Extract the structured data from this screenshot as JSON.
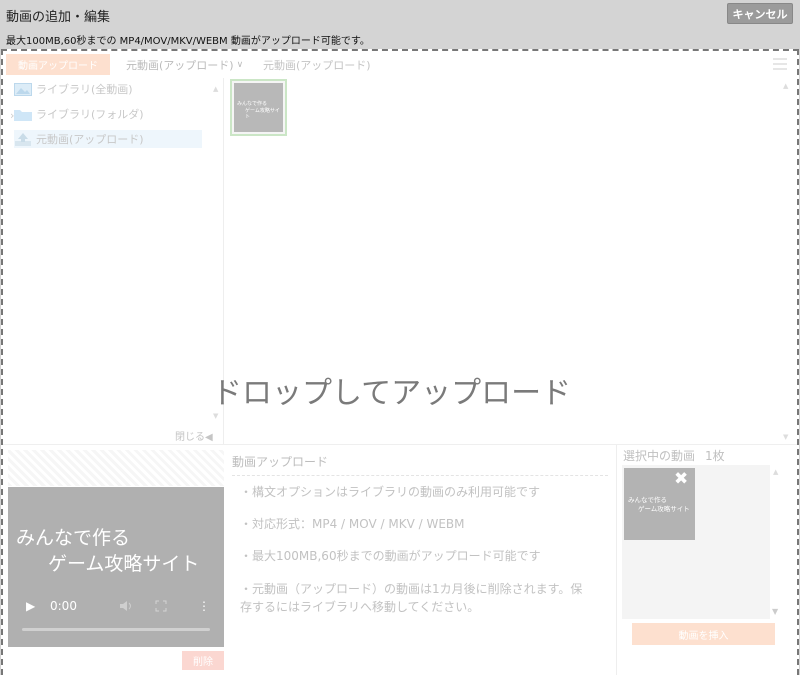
{
  "header": {
    "title": "動画の追加・編集",
    "cancel_label": "キャンセル",
    "note": "最大100MB,60秒までの MP4/MOV/MKV/WEBM 動画がアップロード可能です。"
  },
  "toolbar": {
    "upload_tab": "動画アップロード",
    "source_select": "元動画(アップロード)",
    "breadcrumb": "元動画(アップロード)"
  },
  "sidebar": {
    "items": [
      {
        "label": "ライブラリ(全動画)",
        "icon": "image-icon"
      },
      {
        "label": "ライブラリ(フォルダ)",
        "icon": "folder-icon"
      },
      {
        "label": "元動画(アップロード)",
        "icon": "upload-icon"
      }
    ],
    "close_label": "閉じる◀"
  },
  "grid": {
    "thumb_line1": "みんなで作る",
    "thumb_line2": "ゲーム攻略サイト"
  },
  "drop_text": "ドロップしてアップロード",
  "preview": {
    "line1": "みんなで作る",
    "line2": "ゲーム攻略サイト",
    "time": "0:00",
    "delete_label": "削除"
  },
  "info": {
    "title": "動画アップロード",
    "lines": [
      "・構文オプションはライブラリの動画のみ利用可能です",
      "・対応形式：MP4 / MOV / MKV / WEBM",
      "・最大100MB,60秒までの動画がアップロード可能です",
      "・元動画（アップロード）の動画は1カ月後に削除されます。保",
      "存するにはライブラリへ移動してください。"
    ]
  },
  "selected": {
    "title": "選択中の動画",
    "count": "1枚",
    "thumb_line1": "みんなで作る",
    "thumb_line2": "ゲーム攻略サイト",
    "insert_label": "動画を挿入"
  },
  "colors": {
    "accent": "#f5a57a",
    "delete": "#f08c7c",
    "selected_border": "#a7d39c"
  }
}
